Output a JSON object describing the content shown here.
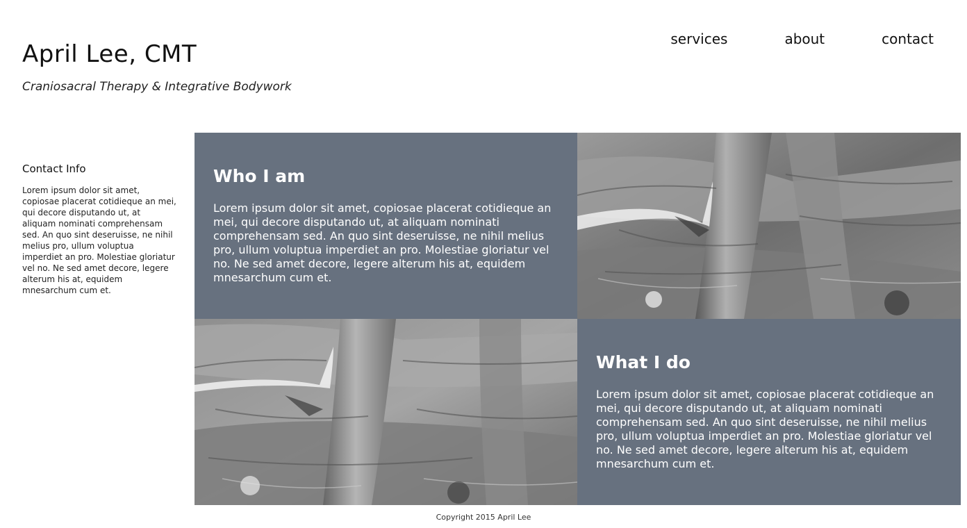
{
  "header": {
    "title": "April Lee, CMT",
    "tagline": "Craniosacral Therapy & Integrative Bodywork"
  },
  "nav": {
    "items": [
      {
        "label": "services"
      },
      {
        "label": "about"
      },
      {
        "label": "contact"
      }
    ]
  },
  "sidebar": {
    "heading": "Contact Info",
    "text": "Lorem ipsum dolor sit amet, copiosae placerat cotidieque an mei, qui decore disputando ut, at aliquam nominati comprehensam sed. An quo sint deseruisse, ne nihil melius pro, ullum voluptua imperdiet an pro. Molestiae gloriatur vel no. Ne sed amet decore, legere alterum his at, equidem mnesarchum cum et."
  },
  "sections": [
    {
      "heading": "Who I am",
      "text": "Lorem ipsum dolor sit amet, copiosae placerat cotidieque an mei, qui decore disputando ut, at aliquam nominati comprehensam sed. An quo sint deseruisse, ne nihil melius pro, ullum voluptua imperdiet an pro. Molestiae gloriatur vel no. Ne sed amet decore, legere alterum his at, equidem mnesarchum cum et."
    },
    {
      "heading": "What I do",
      "text": "Lorem ipsum dolor sit amet, copiosae placerat cotidieque an mei, qui decore disputando ut, at aliquam nominati comprehensam sed. An quo sint deseruisse, ne nihil melius pro, ullum voluptua imperdiet an pro. Molestiae gloriatur vel no. Ne sed amet decore, legere alterum his at, equidem mnesarchum cum et."
    }
  ],
  "footer": {
    "copyright": "Copyright 2015 April Lee"
  },
  "colors": {
    "panel": "#67717f",
    "text": "#111111"
  }
}
